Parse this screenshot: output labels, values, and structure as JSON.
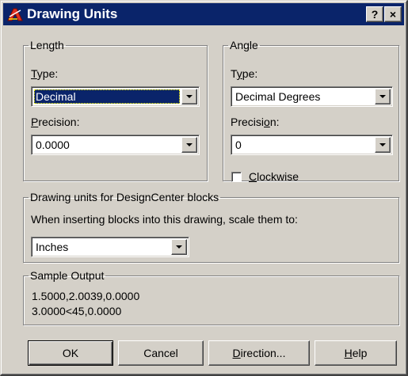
{
  "window": {
    "title": "Drawing Units",
    "help_label": "?",
    "close_label": "×"
  },
  "length": {
    "group_label": "Length",
    "type_label_key": "T",
    "type_label_rest": "ype:",
    "type_value": "Decimal",
    "precision_label_key": "P",
    "precision_label_rest": "recision:",
    "precision_value": "0.0000"
  },
  "angle": {
    "group_label": "Angle",
    "type_label_pre": "T",
    "type_label_key": "y",
    "type_label_rest": "pe:",
    "type_value": "Decimal Degrees",
    "precision_label_pre": "Precisi",
    "precision_label_key": "o",
    "precision_label_rest": "n:",
    "precision_value": "0",
    "clockwise_key": "C",
    "clockwise_rest": "lockwise",
    "clockwise_checked": false
  },
  "designcenter": {
    "group_label": "Drawing units for DesignCenter blocks",
    "description": "When inserting blocks into this drawing, scale them to:",
    "units_value": "Inches"
  },
  "sample": {
    "group_label": "Sample Output",
    "lines": [
      "1.5000,2.0039,0.0000",
      "3.0000<45,0.0000"
    ]
  },
  "buttons": {
    "ok": "OK",
    "cancel": "Cancel",
    "direction_key": "D",
    "direction_rest": "irection...",
    "help_key": "H",
    "help_rest": "elp"
  }
}
